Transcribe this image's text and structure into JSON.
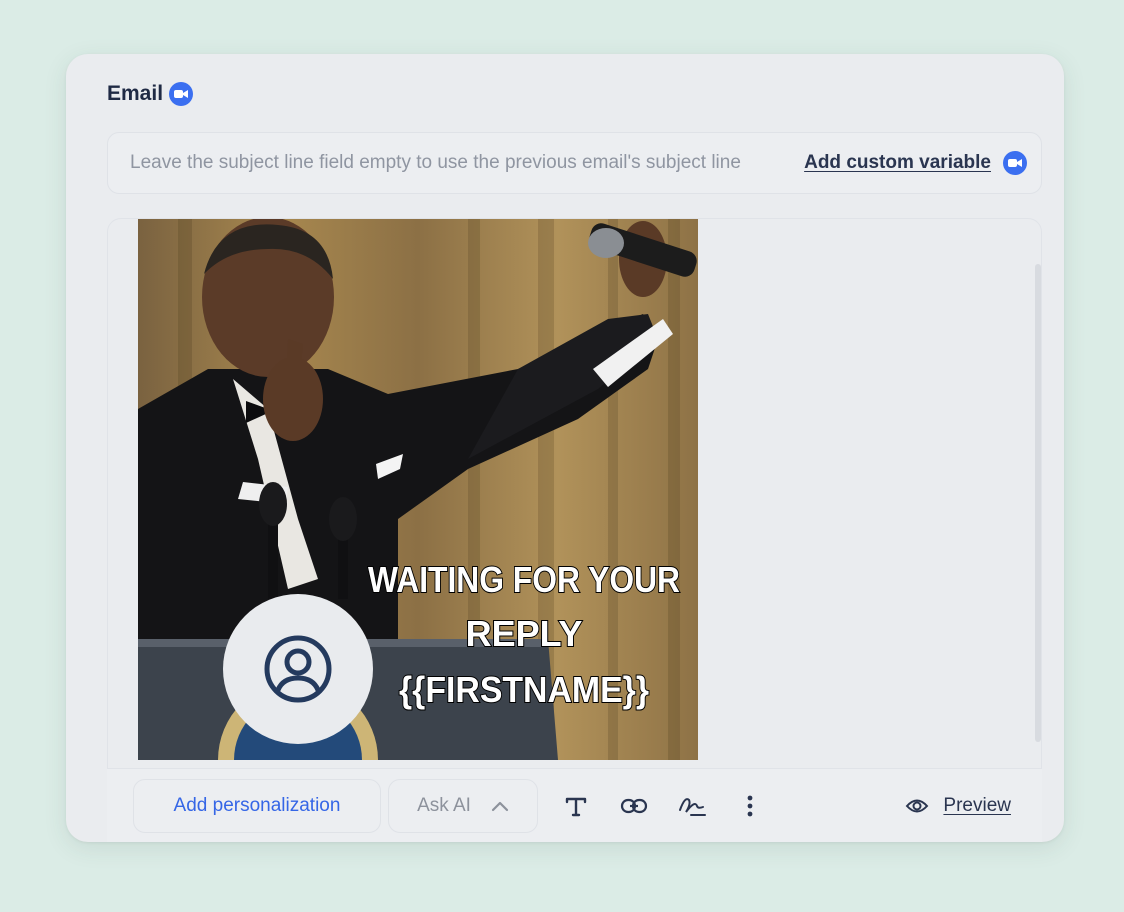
{
  "card": {
    "title": "Email",
    "subject_placeholder": "Leave the subject line field empty to use the previous email's subject line",
    "custom_variable_label": "Add custom variable"
  },
  "gif": {
    "caption_line1": "WAITING FOR YOUR",
    "caption_line2": "REPLY",
    "caption_line3": "{{FIRSTNAME}}"
  },
  "toolbar": {
    "personalization_label": "Add personalization",
    "ask_ai_label": "Ask AI",
    "preview_label": "Preview",
    "icons": [
      "text-format-icon",
      "link-icon",
      "signature-icon",
      "more-vertical-icon",
      "eye-icon"
    ]
  },
  "colors": {
    "accent": "#3566e6",
    "badge": "#3b6ff0",
    "background": "#dbece6",
    "card": "#eaecef"
  }
}
